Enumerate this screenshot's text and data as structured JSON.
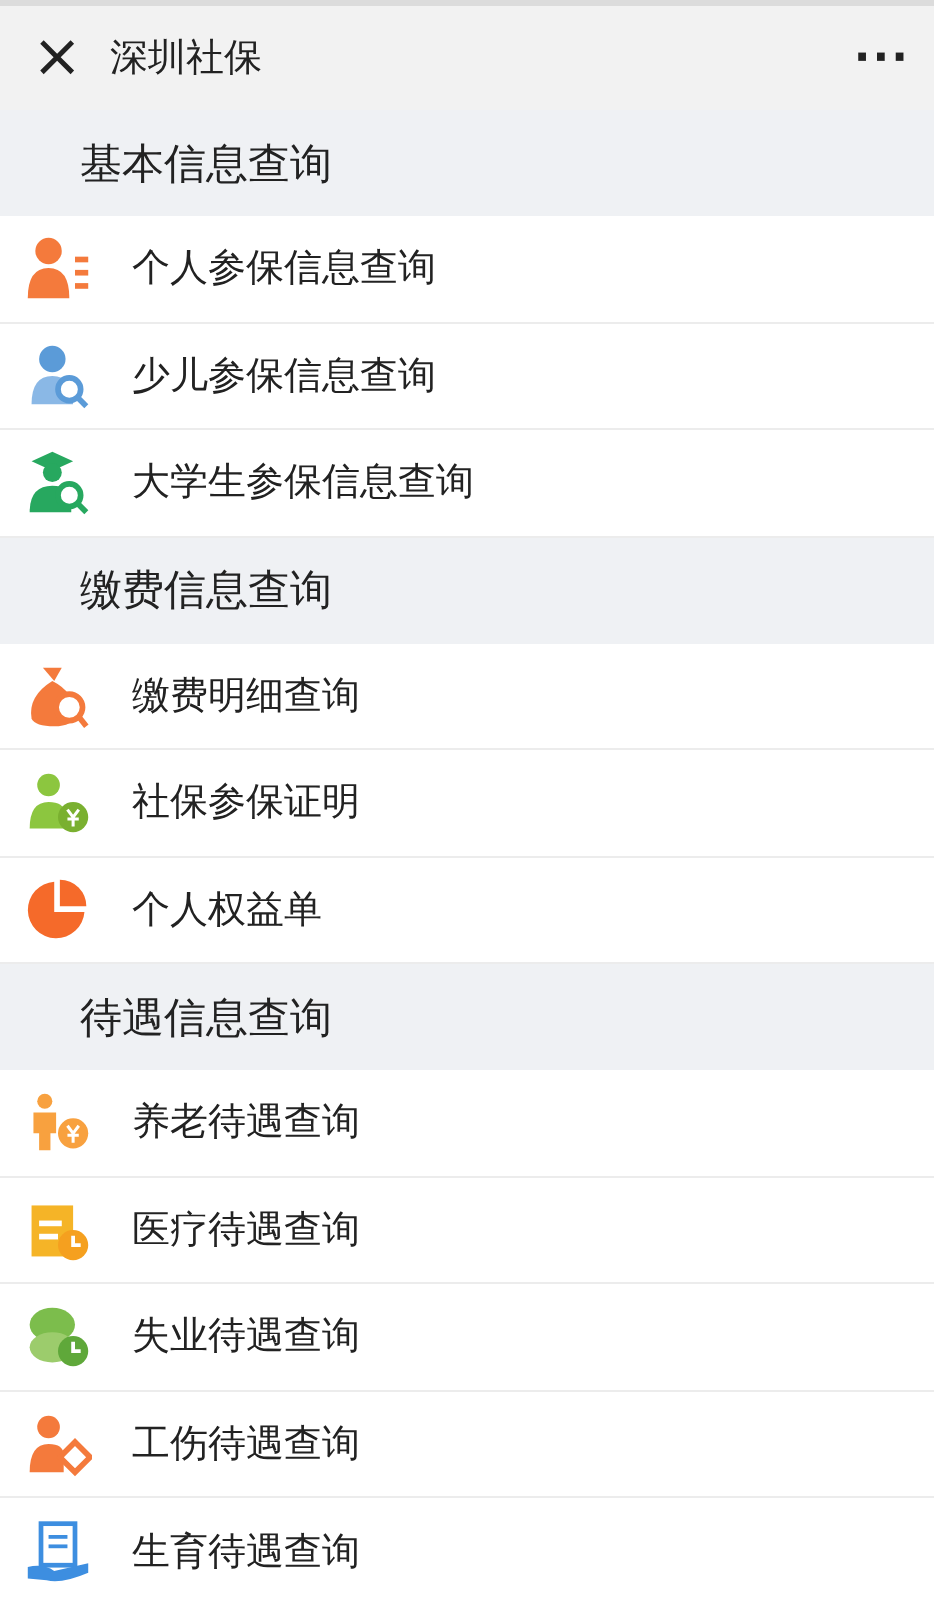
{
  "header": {
    "close": "×",
    "title": "深圳社保",
    "more": "···"
  },
  "sections": [
    {
      "title": "基本信息查询",
      "items": [
        {
          "label": "个人参保信息查询",
          "kind": "person-list"
        },
        {
          "label": "少儿参保信息查询",
          "kind": "child-search"
        },
        {
          "label": "大学生参保信息查询",
          "kind": "graduate-search"
        }
      ]
    },
    {
      "title": "缴费信息查询",
      "items": [
        {
          "label": "缴费明细查询",
          "kind": "money-bag"
        },
        {
          "label": "社保参保证明",
          "kind": "person-yuan"
        },
        {
          "label": "个人权益单",
          "kind": "pie"
        }
      ]
    },
    {
      "title": "待遇信息查询",
      "items": [
        {
          "label": "养老待遇查询",
          "kind": "elder-yuan"
        },
        {
          "label": "医疗待遇查询",
          "kind": "calendar-clock"
        },
        {
          "label": "失业待遇查询",
          "kind": "coins-clock"
        },
        {
          "label": "工伤待遇查询",
          "kind": "person-diamond"
        },
        {
          "label": "生育待遇查询",
          "kind": "hand-document"
        }
      ]
    }
  ]
}
